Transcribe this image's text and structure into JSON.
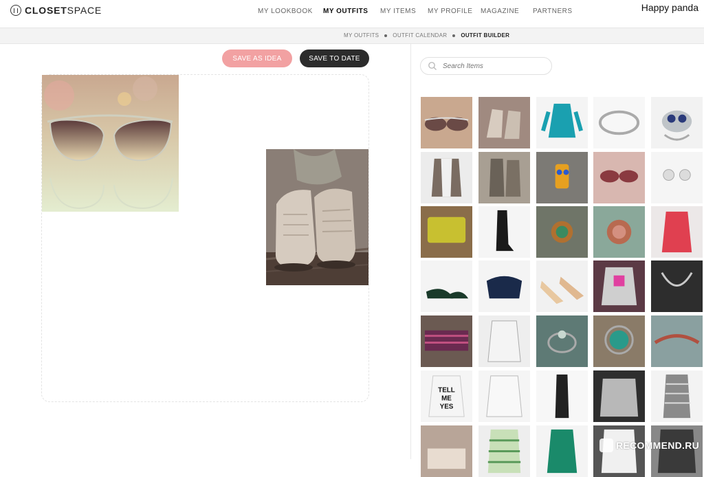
{
  "brand": {
    "bold": "CLOSET",
    "light": "SPACE"
  },
  "nav": {
    "items": [
      {
        "label": "MY LOOKBOOK"
      },
      {
        "label": "MY OUTFITS"
      },
      {
        "label": "MY ITEMS"
      },
      {
        "label": "MY PROFILE"
      },
      {
        "label": "MAGAZINE"
      },
      {
        "label": "PARTNERS"
      }
    ],
    "active": "MY OUTFITS"
  },
  "user": {
    "name": "Happy panda"
  },
  "subnav": {
    "items": [
      {
        "label": "MY OUTFITS"
      },
      {
        "label": "OUTFIT CALENDAR"
      },
      {
        "label": "OUTFIT BUILDER"
      }
    ],
    "active": "OUTFIT BUILDER"
  },
  "actions": {
    "save_idea": "SAVE AS IDEA",
    "save_date": "SAVE TO DATE"
  },
  "search": {
    "placeholder": "Search Items"
  },
  "canvas_items": [
    {
      "name": "sunglasses",
      "icon": "sunglasses-icon"
    },
    {
      "name": "lace-up boots",
      "icon": "boots-icon"
    }
  ],
  "closet_items": [
    {
      "name": "sunglasses",
      "bg": "#c9a88f"
    },
    {
      "name": "lace boots",
      "bg": "#a08a80"
    },
    {
      "name": "teal coat",
      "bg": "#f4f4f4"
    },
    {
      "name": "silver bracelet",
      "bg": "#f7f7f7"
    },
    {
      "name": "owl ring",
      "bg": "#f2f2f2"
    },
    {
      "name": "fur vest",
      "bg": "#ececec"
    },
    {
      "name": "ankle boots",
      "bg": "#a89f93"
    },
    {
      "name": "owl pendant",
      "bg": "#7c7a75"
    },
    {
      "name": "sunglasses",
      "bg": "#d8b7b0"
    },
    {
      "name": "pearl earrings",
      "bg": "#f5f5f5"
    },
    {
      "name": "yellow bag",
      "bg": "#8a6d4a"
    },
    {
      "name": "tall boots",
      "bg": "#f5f5f5"
    },
    {
      "name": "glass bead",
      "bg": "#6f7568"
    },
    {
      "name": "stone ring",
      "bg": "#8aa89a"
    },
    {
      "name": "pink coat",
      "bg": "#ece8e8"
    },
    {
      "name": "green pumps",
      "bg": "#f4f4f4"
    },
    {
      "name": "navy clutch",
      "bg": "#f4f4f4"
    },
    {
      "name": "painted heels",
      "bg": "#f1f1f1"
    },
    {
      "name": "grey sweater",
      "bg": "#5b3a45"
    },
    {
      "name": "chain necklace",
      "bg": "#2d2d2d"
    },
    {
      "name": "striped scarf",
      "bg": "#6b5a52"
    },
    {
      "name": "lace top",
      "bg": "#eeeeee"
    },
    {
      "name": "glass ring",
      "bg": "#5e7a75"
    },
    {
      "name": "turquoise ring",
      "bg": "#8a7b68"
    },
    {
      "name": "bead bracelet",
      "bg": "#8aa0a0"
    },
    {
      "name": "slogan sweater",
      "bg": "#f5f5f5"
    },
    {
      "name": "white blouse",
      "bg": "#f5f5f5"
    },
    {
      "name": "black outfit",
      "bg": "#f7f7f7"
    },
    {
      "name": "grey knit",
      "bg": "#2e2e2e"
    },
    {
      "name": "striped dress",
      "bg": "#f3f3f3"
    },
    {
      "name": "clutch",
      "bg": "#b8a598"
    },
    {
      "name": "green stripe top",
      "bg": "#eeeeee"
    },
    {
      "name": "green coat",
      "bg": "#f4f4f4"
    },
    {
      "name": "hoodie",
      "bg": "#555555"
    },
    {
      "name": "dark coat",
      "bg": "#888888"
    }
  ],
  "watermark": {
    "text": "RECOMMEND.RU"
  }
}
